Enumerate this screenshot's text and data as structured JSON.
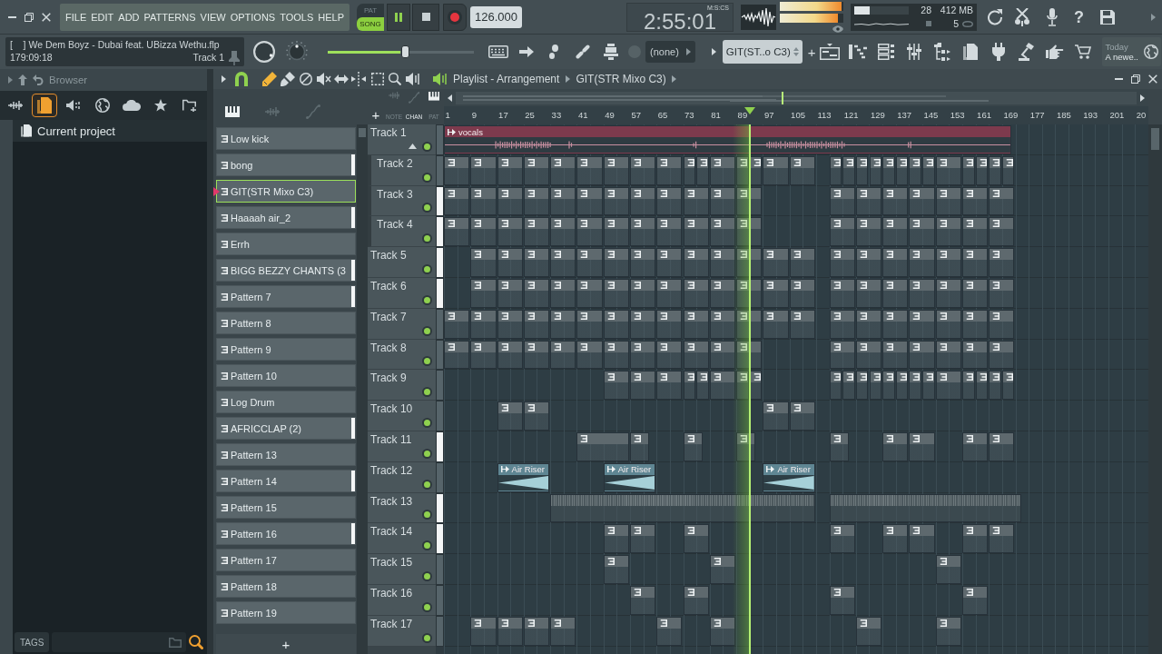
{
  "menu": [
    "FILE",
    "EDIT",
    "ADD",
    "PATTERNS",
    "VIEW",
    "OPTIONS",
    "TOOLS",
    "HELP"
  ],
  "transport": {
    "modes": [
      {
        "label": "PAT",
        "selected": false
      },
      {
        "label": "SONG",
        "selected": true
      }
    ],
    "playing": true,
    "tempo": "126.000"
  },
  "clock": {
    "time": "2:55:01",
    "format": "M:S:CS"
  },
  "master_meters": [
    {
      "level": 0.97
    },
    {
      "level": 0.92
    }
  ],
  "performance": {
    "cpu": {
      "level": 0.28,
      "reading": "28"
    },
    "memory": "412 MB",
    "polyphony": "5"
  },
  "help": "?",
  "hint_bar": {
    "text": "[    ] We Dem Boyz - Dubai feat. UBizza Wethu.flp",
    "time": "179:09:18",
    "target": "Track 1"
  },
  "master_slider": {
    "level": 0.53
  },
  "channel_select": {
    "value": "(none)"
  },
  "pattern_select": {
    "value": "GIT(ST..o C3)",
    "add": "+"
  },
  "news": {
    "title": "Today",
    "text": "A newe.."
  },
  "browser": {
    "title": "Browser",
    "tabs": [
      {
        "selected": false
      },
      {
        "selected": true
      },
      {
        "selected": false
      },
      {
        "selected": false
      },
      {
        "selected": false
      },
      {
        "selected": false
      },
      {
        "selected": false
      }
    ],
    "items": [
      {
        "label": "Current project",
        "selected": true
      }
    ],
    "tags": "TAGS"
  },
  "playlist": {
    "title": "Playlist - Arrangement",
    "pattern": "GIT(STR Mixo C3)",
    "snap": true,
    "tools": [
      {
        "selected": true
      },
      {
        "selected": false
      },
      {
        "selected": false
      },
      {
        "selected": false
      },
      {
        "selected": false
      },
      {
        "selected": false
      },
      {
        "selected": false
      },
      {
        "selected": false
      },
      {
        "selected": false
      }
    ],
    "picker_views": [
      {
        "selected": true
      },
      {
        "selected": false
      },
      {
        "selected": false
      }
    ],
    "add": "+",
    "clip_filters": [
      {
        "selected": false
      },
      {
        "selected": false
      },
      {
        "selected": true
      }
    ],
    "filter_labels": [
      {
        "label": "NOTE",
        "selected": false
      },
      {
        "label": "CHAN",
        "selected": true
      },
      {
        "label": "PAT",
        "selected": false
      }
    ],
    "patterns": [
      {
        "name": "Low kick",
        "selected": false,
        "marked": false
      },
      {
        "name": "bong",
        "selected": false,
        "marked": true
      },
      {
        "name": "GIT(STR Mixo C3)",
        "selected": true,
        "marked": false
      },
      {
        "name": "Haaaah air_2",
        "selected": false,
        "marked": true
      },
      {
        "name": "Errh",
        "selected": false,
        "marked": false
      },
      {
        "name": "BIGG BEZZY CHANTS (3",
        "selected": false,
        "marked": true
      },
      {
        "name": "Pattern 7",
        "selected": false,
        "marked": true
      },
      {
        "name": "Pattern 8",
        "selected": false,
        "marked": false
      },
      {
        "name": "Pattern 9",
        "selected": false,
        "marked": false
      },
      {
        "name": "Pattern 10",
        "selected": false,
        "marked": false
      },
      {
        "name": "Log Drum",
        "selected": false,
        "marked": false
      },
      {
        "name": "AFRICCLAP (2)",
        "selected": false,
        "marked": true
      },
      {
        "name": "Pattern 13",
        "selected": false,
        "marked": false
      },
      {
        "name": "Pattern 14",
        "selected": false,
        "marked": true
      },
      {
        "name": "Pattern 15",
        "selected": false,
        "marked": false
      },
      {
        "name": "Pattern 16",
        "selected": false,
        "marked": true
      },
      {
        "name": "Pattern 17",
        "selected": false,
        "marked": false
      },
      {
        "name": "Pattern 18",
        "selected": false,
        "marked": false
      },
      {
        "name": "Pattern 19",
        "selected": false,
        "marked": false
      }
    ],
    "add_pattern": "+",
    "overview": {
      "level": 0.48
    },
    "ruler": [
      "1",
      "9",
      "17",
      "25",
      "33",
      "41",
      "49",
      "57",
      "65",
      "73",
      "81",
      "89",
      "97",
      "105",
      "113",
      "121",
      "129",
      "137",
      "145",
      "153",
      "161",
      "169",
      "177",
      "185",
      "193",
      "201",
      "20"
    ],
    "playhead": {
      "level": 0.434
    },
    "tracks": [
      {
        "name": "Track 1",
        "enabled": true,
        "selected": false,
        "expanded": true,
        "clips": [
          {
            "kind": "audio",
            "label": "vocals",
            "color": "#7d3a4d"
          }
        ],
        "children": [
          {
            "name": "Track 2",
            "enabled": true,
            "selected": false,
            "clips": [
              {
                "kind": "pattern"
              },
              {
                "kind": "pattern"
              },
              {
                "kind": "pattern"
              },
              {
                "kind": "pattern"
              },
              {
                "kind": "pattern"
              },
              {
                "kind": "pattern"
              },
              {
                "kind": "pattern"
              },
              {
                "kind": "pattern"
              },
              {
                "kind": "pattern"
              },
              {
                "kind": "pattern"
              },
              {
                "kind": "pattern"
              },
              {
                "kind": "pattern"
              },
              {
                "kind": "pattern"
              },
              {
                "kind": "pattern"
              },
              {
                "kind": "pattern"
              },
              {
                "kind": "pattern"
              },
              {
                "kind": "pattern"
              },
              {
                "kind": "pattern"
              },
              {
                "kind": "pattern"
              },
              {
                "kind": "pattern"
              },
              {
                "kind": "pattern"
              },
              {
                "kind": "pattern"
              },
              {
                "kind": "pattern"
              },
              {
                "kind": "pattern"
              },
              {
                "kind": "pattern"
              },
              {
                "kind": "pattern"
              },
              {
                "kind": "pattern"
              },
              {
                "kind": "pattern"
              },
              {
                "kind": "pattern"
              }
            ]
          },
          {
            "name": "Track 3",
            "enabled": true,
            "selected": true,
            "clips": [
              {
                "kind": "pattern"
              },
              {
                "kind": "pattern"
              },
              {
                "kind": "pattern"
              },
              {
                "kind": "pattern"
              },
              {
                "kind": "pattern"
              },
              {
                "kind": "pattern"
              },
              {
                "kind": "pattern"
              },
              {
                "kind": "pattern"
              },
              {
                "kind": "pattern"
              },
              {
                "kind": "pattern"
              },
              {
                "kind": "pattern"
              },
              {
                "kind": "pattern"
              },
              {
                "kind": "pattern"
              },
              {
                "kind": "pattern"
              },
              {
                "kind": "pattern"
              },
              {
                "kind": "pattern"
              },
              {
                "kind": "pattern"
              },
              {
                "kind": "pattern"
              },
              {
                "kind": "pattern"
              }
            ]
          },
          {
            "name": "Track 4",
            "enabled": true,
            "selected": true,
            "clips": [
              {
                "kind": "pattern"
              },
              {
                "kind": "pattern"
              },
              {
                "kind": "pattern"
              },
              {
                "kind": "pattern"
              },
              {
                "kind": "pattern"
              },
              {
                "kind": "pattern"
              },
              {
                "kind": "pattern"
              },
              {
                "kind": "pattern"
              },
              {
                "kind": "pattern"
              },
              {
                "kind": "pattern"
              },
              {
                "kind": "pattern"
              },
              {
                "kind": "pattern"
              },
              {
                "kind": "pattern"
              },
              {
                "kind": "pattern"
              },
              {
                "kind": "pattern"
              },
              {
                "kind": "pattern"
              },
              {
                "kind": "pattern"
              },
              {
                "kind": "pattern"
              },
              {
                "kind": "pattern"
              }
            ]
          }
        ]
      },
      {
        "name": "Track 5",
        "enabled": true,
        "selected": true,
        "clips": [
          {
            "kind": "pattern"
          },
          {
            "kind": "pattern"
          },
          {
            "kind": "pattern"
          },
          {
            "kind": "pattern"
          },
          {
            "kind": "pattern"
          },
          {
            "kind": "pattern"
          },
          {
            "kind": "pattern"
          },
          {
            "kind": "pattern"
          },
          {
            "kind": "pattern"
          },
          {
            "kind": "pattern"
          },
          {
            "kind": "pattern"
          },
          {
            "kind": "pattern"
          },
          {
            "kind": "pattern"
          },
          {
            "kind": "pattern"
          },
          {
            "kind": "pattern"
          },
          {
            "kind": "pattern"
          },
          {
            "kind": "pattern"
          },
          {
            "kind": "pattern"
          },
          {
            "kind": "pattern"
          },
          {
            "kind": "pattern"
          }
        ]
      },
      {
        "name": "Track 6",
        "enabled": true,
        "selected": true,
        "clips": [
          {
            "kind": "pattern"
          },
          {
            "kind": "pattern"
          },
          {
            "kind": "pattern"
          },
          {
            "kind": "pattern"
          },
          {
            "kind": "pattern"
          },
          {
            "kind": "pattern"
          },
          {
            "kind": "pattern"
          },
          {
            "kind": "pattern"
          },
          {
            "kind": "pattern"
          },
          {
            "kind": "pattern"
          },
          {
            "kind": "pattern"
          },
          {
            "kind": "pattern"
          },
          {
            "kind": "pattern"
          },
          {
            "kind": "pattern"
          },
          {
            "kind": "pattern"
          },
          {
            "kind": "pattern"
          },
          {
            "kind": "pattern"
          },
          {
            "kind": "pattern"
          },
          {
            "kind": "pattern"
          },
          {
            "kind": "pattern"
          }
        ]
      },
      {
        "name": "Track 7",
        "enabled": true,
        "selected": false,
        "clips": [
          {
            "kind": "pattern"
          },
          {
            "kind": "pattern"
          },
          {
            "kind": "pattern"
          },
          {
            "kind": "pattern"
          },
          {
            "kind": "pattern"
          },
          {
            "kind": "pattern"
          },
          {
            "kind": "pattern"
          },
          {
            "kind": "pattern"
          },
          {
            "kind": "pattern"
          },
          {
            "kind": "pattern"
          },
          {
            "kind": "pattern"
          },
          {
            "kind": "pattern"
          },
          {
            "kind": "pattern"
          },
          {
            "kind": "pattern"
          },
          {
            "kind": "pattern"
          },
          {
            "kind": "pattern"
          },
          {
            "kind": "pattern"
          },
          {
            "kind": "pattern"
          },
          {
            "kind": "pattern"
          },
          {
            "kind": "pattern"
          },
          {
            "kind": "pattern"
          }
        ]
      },
      {
        "name": "Track 8",
        "enabled": true,
        "selected": false,
        "clips": [
          {
            "kind": "pattern"
          },
          {
            "kind": "pattern"
          },
          {
            "kind": "pattern"
          },
          {
            "kind": "pattern"
          },
          {
            "kind": "pattern"
          },
          {
            "kind": "pattern"
          },
          {
            "kind": "pattern"
          },
          {
            "kind": "pattern"
          },
          {
            "kind": "pattern"
          },
          {
            "kind": "pattern"
          },
          {
            "kind": "pattern"
          },
          {
            "kind": "pattern"
          },
          {
            "kind": "pattern"
          },
          {
            "kind": "pattern"
          },
          {
            "kind": "pattern"
          },
          {
            "kind": "pattern"
          },
          {
            "kind": "pattern"
          },
          {
            "kind": "pattern"
          },
          {
            "kind": "pattern"
          }
        ]
      },
      {
        "name": "Track 9",
        "enabled": true,
        "selected": false,
        "clips": [
          {
            "kind": "pattern"
          },
          {
            "kind": "pattern"
          },
          {
            "kind": "pattern"
          },
          {
            "kind": "pattern"
          },
          {
            "kind": "pattern"
          },
          {
            "kind": "pattern"
          },
          {
            "kind": "pattern"
          },
          {
            "kind": "pattern"
          },
          {
            "kind": "pattern"
          },
          {
            "kind": "pattern"
          },
          {
            "kind": "pattern"
          },
          {
            "kind": "pattern"
          },
          {
            "kind": "pattern"
          },
          {
            "kind": "pattern"
          },
          {
            "kind": "pattern"
          },
          {
            "kind": "pattern"
          },
          {
            "kind": "pattern"
          },
          {
            "kind": "pattern"
          },
          {
            "kind": "pattern"
          },
          {
            "kind": "pattern"
          },
          {
            "kind": "pattern"
          }
        ]
      },
      {
        "name": "Track 10",
        "enabled": true,
        "selected": false,
        "clips": [
          {
            "kind": "pattern"
          },
          {
            "kind": "pattern"
          },
          {
            "kind": "pattern"
          },
          {
            "kind": "pattern"
          }
        ]
      },
      {
        "name": "Track 11",
        "enabled": true,
        "selected": true,
        "clips": [
          {
            "kind": "pattern"
          },
          {
            "kind": "pattern"
          },
          {
            "kind": "pattern"
          },
          {
            "kind": "pattern"
          },
          {
            "kind": "pattern"
          },
          {
            "kind": "pattern"
          },
          {
            "kind": "pattern"
          },
          {
            "kind": "pattern"
          },
          {
            "kind": "pattern"
          }
        ]
      },
      {
        "name": "Track 12",
        "enabled": true,
        "selected": false,
        "clips": [
          {
            "kind": "ramp",
            "label": "Air Riser",
            "color": "#5f8693"
          },
          {
            "kind": "ramp",
            "label": "Air Riser",
            "color": "#5f8693"
          },
          {
            "kind": "ramp",
            "label": "Air Riser",
            "color": "#5f8693"
          }
        ]
      },
      {
        "name": "Track 13",
        "enabled": true,
        "selected": true,
        "clips": [
          {
            "kind": "sample"
          },
          {
            "kind": "sample"
          }
        ]
      },
      {
        "name": "Track 14",
        "enabled": true,
        "selected": true,
        "clips": [
          {
            "kind": "pattern"
          },
          {
            "kind": "pattern"
          },
          {
            "kind": "pattern"
          },
          {
            "kind": "pattern"
          },
          {
            "kind": "pattern"
          },
          {
            "kind": "pattern"
          },
          {
            "kind": "pattern"
          },
          {
            "kind": "pattern"
          }
        ]
      },
      {
        "name": "Track 15",
        "enabled": true,
        "selected": false,
        "clips": [
          {
            "kind": "pattern"
          },
          {
            "kind": "pattern"
          },
          {
            "kind": "pattern"
          }
        ]
      },
      {
        "name": "Track 16",
        "enabled": true,
        "selected": false,
        "clips": [
          {
            "kind": "pattern"
          },
          {
            "kind": "pattern"
          },
          {
            "kind": "pattern"
          },
          {
            "kind": "pattern"
          }
        ]
      },
      {
        "name": "Track 17",
        "enabled": true,
        "selected": false,
        "clips": [
          {
            "kind": "pattern"
          },
          {
            "kind": "pattern"
          },
          {
            "kind": "pattern"
          },
          {
            "kind": "pattern"
          },
          {
            "kind": "pattern"
          },
          {
            "kind": "pattern"
          },
          {
            "kind": "pattern"
          },
          {
            "kind": "pattern"
          }
        ]
      }
    ]
  }
}
